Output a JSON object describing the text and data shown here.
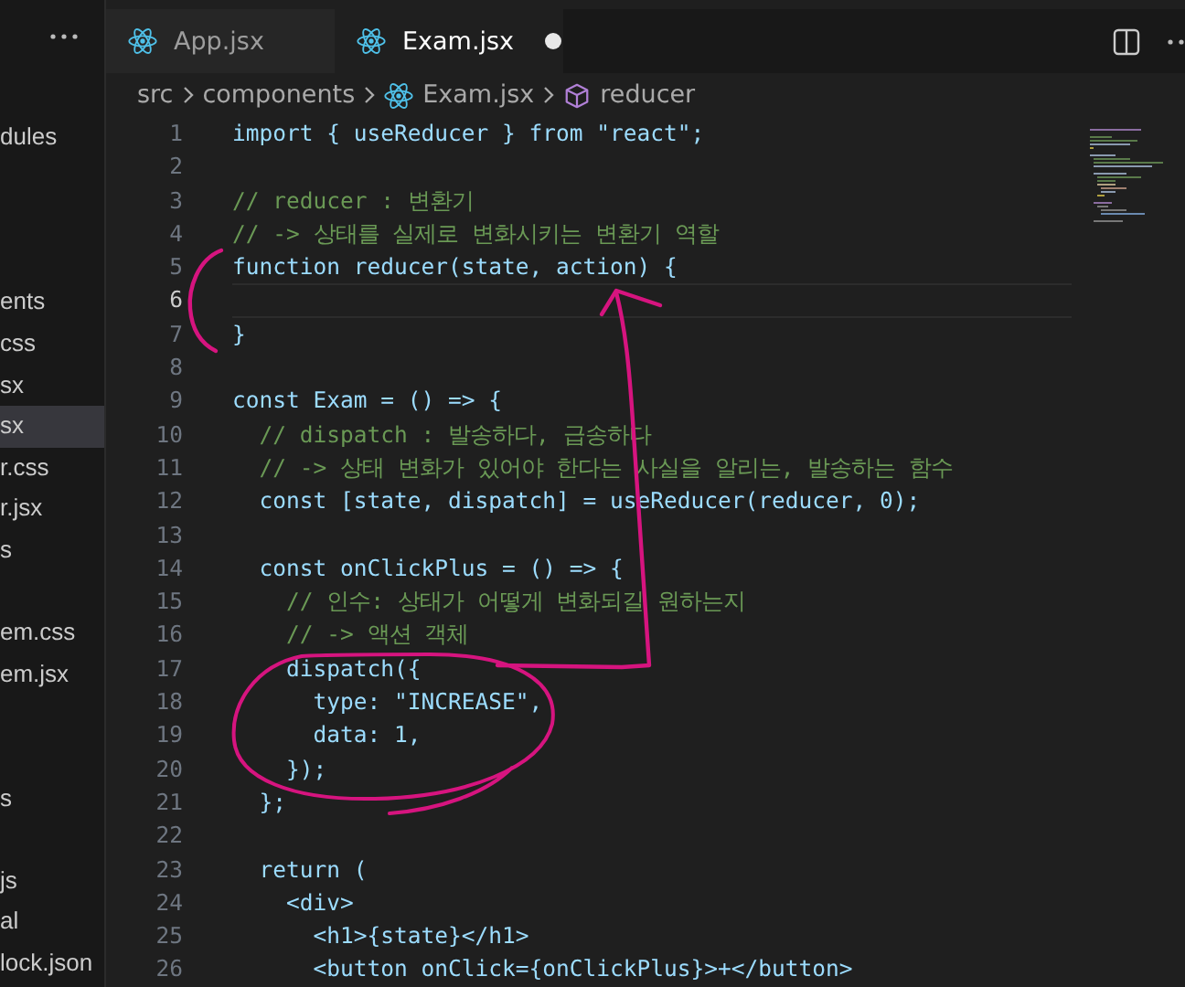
{
  "sidebar": {
    "items": [
      {
        "kind": "file",
        "label": "dules",
        "selected": false
      },
      {
        "kind": "hidden"
      },
      {
        "kind": "hidden"
      },
      {
        "kind": "hidden"
      },
      {
        "kind": "file",
        "label": "ents",
        "selected": false
      },
      {
        "kind": "file",
        "label": "css",
        "selected": false
      },
      {
        "kind": "file",
        "label": "sx",
        "selected": false
      },
      {
        "kind": "file",
        "label": "sx",
        "selected": true
      },
      {
        "kind": "file",
        "label": "r.css",
        "selected": false
      },
      {
        "kind": "file",
        "label": "r.jsx",
        "selected": false
      },
      {
        "kind": "file",
        "label": "s",
        "selected": false
      },
      {
        "kind": "hidden"
      },
      {
        "kind": "file",
        "label": "em.css",
        "selected": false
      },
      {
        "kind": "file",
        "label": "em.jsx",
        "selected": false
      },
      {
        "kind": "hidden"
      },
      {
        "kind": "hidden"
      },
      {
        "kind": "file",
        "label": "s",
        "selected": false
      },
      {
        "kind": "hidden"
      },
      {
        "kind": "file",
        "label": "js",
        "selected": false
      },
      {
        "kind": "file",
        "label": "al",
        "selected": false
      },
      {
        "kind": "file",
        "label": "lock.json",
        "selected": false
      }
    ]
  },
  "tabs": [
    {
      "label": "App.jsx",
      "selected": false,
      "modified": false
    },
    {
      "label": "Exam.jsx",
      "selected": true,
      "modified": true
    }
  ],
  "breadcrumb": [
    {
      "kind": "folder",
      "label": "src"
    },
    {
      "kind": "folder",
      "label": "components"
    },
    {
      "kind": "file",
      "label": "Exam.jsx"
    },
    {
      "kind": "symbol",
      "label": "reducer"
    }
  ],
  "code": {
    "lines": [
      {
        "number": "1",
        "current": false,
        "kind": "code",
        "text": "import { useReducer } from \"react\";"
      },
      {
        "number": "2",
        "current": false,
        "kind": "blank"
      },
      {
        "number": "3",
        "current": false,
        "kind": "comment",
        "text": "// reducer : 변환기"
      },
      {
        "number": "4",
        "current": false,
        "kind": "comment",
        "text": "// -> 상태를 실제로 변화시키는 변환기 역할"
      },
      {
        "number": "5",
        "current": false,
        "kind": "code",
        "text": "function reducer(state, action) {"
      },
      {
        "number": "6",
        "current": true,
        "kind": "blank"
      },
      {
        "number": "7",
        "current": false,
        "kind": "code",
        "text": "}"
      },
      {
        "number": "8",
        "current": false,
        "kind": "blank"
      },
      {
        "number": "9",
        "current": false,
        "kind": "code",
        "text": "const Exam = () => {"
      },
      {
        "number": "10",
        "current": false,
        "kind": "comment",
        "text": "  // dispatch : 발송하다, 급송하다"
      },
      {
        "number": "11",
        "current": false,
        "kind": "comment",
        "text": "  // -> 상태 변화가 있어야 한다는 사실을 알리는, 발송하는 함수"
      },
      {
        "number": "12",
        "current": false,
        "kind": "code",
        "text": "  const [state, dispatch] = useReducer(reducer, 0);"
      },
      {
        "number": "13",
        "current": false,
        "kind": "blank"
      },
      {
        "number": "14",
        "current": false,
        "kind": "code",
        "text": "  const onClickPlus = () => {"
      },
      {
        "number": "15",
        "current": false,
        "kind": "comment",
        "text": "    // 인수: 상태가 어떻게 변화되길 원하는지"
      },
      {
        "number": "16",
        "current": false,
        "kind": "comment",
        "text": "    // -> 액션 객체"
      },
      {
        "number": "17",
        "current": false,
        "kind": "code",
        "text": "    dispatch({"
      },
      {
        "number": "18",
        "current": false,
        "kind": "code",
        "text": "      type: \"INCREASE\","
      },
      {
        "number": "19",
        "current": false,
        "kind": "code",
        "text": "      data: 1,"
      },
      {
        "number": "20",
        "current": false,
        "kind": "code",
        "text": "    });"
      },
      {
        "number": "21",
        "current": false,
        "kind": "code",
        "text": "  };"
      },
      {
        "number": "22",
        "current": false,
        "kind": "blank"
      },
      {
        "number": "23",
        "current": false,
        "kind": "code",
        "text": "  return ("
      },
      {
        "number": "24",
        "current": false,
        "kind": "code",
        "text": "    <div>"
      },
      {
        "number": "25",
        "current": false,
        "kind": "code",
        "text": "      <h1>{state}</h1>"
      },
      {
        "number": "26",
        "current": false,
        "kind": "code",
        "text": "      <button onClick={onClickPlus}>+</button>"
      }
    ]
  }
}
